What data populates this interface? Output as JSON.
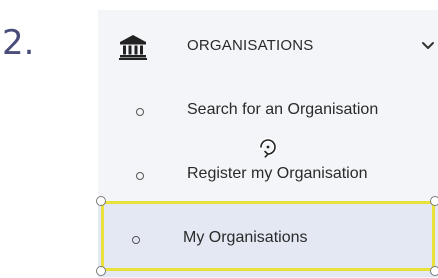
{
  "step": {
    "number": "2."
  },
  "menu": {
    "header": {
      "label": "ORGANISATIONS",
      "icon": "bank-icon",
      "expand_icon": "chevron-down-icon"
    },
    "items": [
      {
        "label": "Search for an Organisation",
        "icon": "bullet-icon"
      },
      {
        "label": "Register my Organisation",
        "icon": "bullet-icon"
      },
      {
        "label": "My Organisations",
        "icon": "bullet-icon",
        "highlighted": true
      }
    ]
  },
  "overlay": {
    "cursor_icon": "rotate-cursor-icon",
    "highlight_color": "#e8e23a"
  },
  "colors": {
    "step_number": "#4a4d7a",
    "panel_bg": "#f3f5f8",
    "selected_bg": "#e3e8f2",
    "text": "#2a2a2a"
  }
}
